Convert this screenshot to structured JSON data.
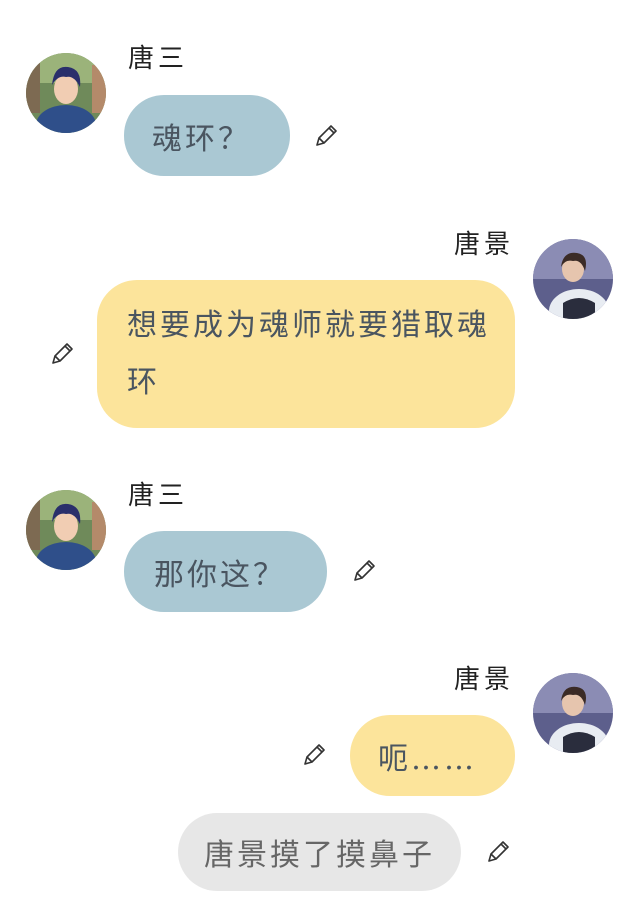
{
  "messages": [
    {
      "sender": "唐三",
      "text": "魂环？"
    },
    {
      "sender": "唐景",
      "text": "想要成为魂师就要猎取魂环"
    },
    {
      "sender": "唐三",
      "text": "那你这？"
    },
    {
      "sender": "唐景",
      "text": "呃……"
    }
  ],
  "narration": {
    "text": "唐景摸了摸鼻子"
  },
  "colors": {
    "left_bubble": "#aac8d3",
    "right_bubble": "#fce49b",
    "narration_bubble": "#e7e7e7"
  },
  "icons": {
    "edit": "pencil-icon"
  }
}
